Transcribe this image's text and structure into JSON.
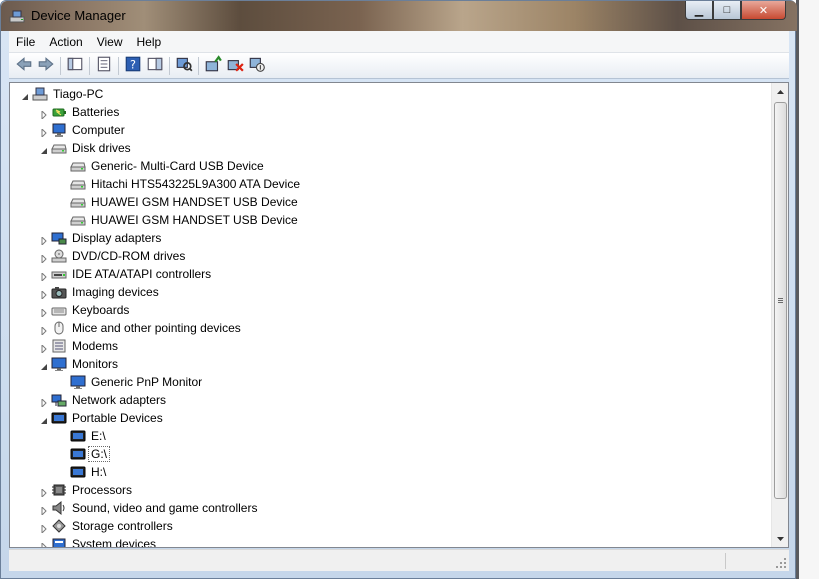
{
  "window": {
    "title": "Device Manager"
  },
  "caption": {
    "minimize": "▁",
    "maximize": "□",
    "close": "✕"
  },
  "menu": [
    "File",
    "Action",
    "View",
    "Help"
  ],
  "toolbar": [
    {
      "icon": "back-arrow-icon"
    },
    {
      "icon": "forward-arrow-icon"
    },
    {
      "sep": true
    },
    {
      "icon": "show-hide-console-tree-icon"
    },
    {
      "sep": true
    },
    {
      "icon": "properties-icon"
    },
    {
      "sep": true
    },
    {
      "icon": "help-icon"
    },
    {
      "icon": "action-pane-icon"
    },
    {
      "sep": true
    },
    {
      "icon": "scan-hardware-changes-icon"
    },
    {
      "sep": true
    },
    {
      "icon": "update-driver-icon"
    },
    {
      "icon": "uninstall-device-icon"
    },
    {
      "icon": "disable-device-icon"
    }
  ],
  "tree": [
    {
      "label": "Tiago-PC",
      "level": 0,
      "state": "expanded",
      "icon": "computer-root-icon"
    },
    {
      "label": "Batteries",
      "level": 1,
      "state": "collapsed",
      "icon": "battery-icon"
    },
    {
      "label": "Computer",
      "level": 1,
      "state": "collapsed",
      "icon": "computer-icon"
    },
    {
      "label": "Disk drives",
      "level": 1,
      "state": "expanded",
      "icon": "disk-drive-icon"
    },
    {
      "label": "Generic- Multi-Card USB Device",
      "level": 2,
      "state": "leaf",
      "icon": "disk-drive-icon"
    },
    {
      "label": "Hitachi HTS543225L9A300 ATA Device",
      "level": 2,
      "state": "leaf",
      "icon": "disk-drive-icon"
    },
    {
      "label": "HUAWEI GSM HANDSET USB Device",
      "level": 2,
      "state": "leaf",
      "icon": "disk-drive-icon"
    },
    {
      "label": "HUAWEI GSM HANDSET USB Device",
      "level": 2,
      "state": "leaf",
      "icon": "disk-drive-icon"
    },
    {
      "label": "Display adapters",
      "level": 1,
      "state": "collapsed",
      "icon": "display-adapter-icon"
    },
    {
      "label": "DVD/CD-ROM drives",
      "level": 1,
      "state": "collapsed",
      "icon": "dvd-drive-icon"
    },
    {
      "label": "IDE ATA/ATAPI controllers",
      "level": 1,
      "state": "collapsed",
      "icon": "ide-controller-icon"
    },
    {
      "label": "Imaging devices",
      "level": 1,
      "state": "collapsed",
      "icon": "camera-icon"
    },
    {
      "label": "Keyboards",
      "level": 1,
      "state": "collapsed",
      "icon": "keyboard-icon"
    },
    {
      "label": "Mice and other pointing devices",
      "level": 1,
      "state": "collapsed",
      "icon": "mouse-icon"
    },
    {
      "label": "Modems",
      "level": 1,
      "state": "collapsed",
      "icon": "modem-icon"
    },
    {
      "label": "Monitors",
      "level": 1,
      "state": "expanded",
      "icon": "monitor-icon"
    },
    {
      "label": "Generic PnP Monitor",
      "level": 2,
      "state": "leaf",
      "icon": "monitor-icon"
    },
    {
      "label": "Network adapters",
      "level": 1,
      "state": "collapsed",
      "icon": "network-adapter-icon"
    },
    {
      "label": "Portable Devices",
      "level": 1,
      "state": "expanded",
      "icon": "portable-device-icon"
    },
    {
      "label": "E:\\",
      "level": 2,
      "state": "leaf",
      "icon": "portable-device-icon"
    },
    {
      "label": "G:\\",
      "level": 2,
      "state": "leaf",
      "icon": "portable-device-icon",
      "selected": true
    },
    {
      "label": "H:\\",
      "level": 2,
      "state": "leaf",
      "icon": "portable-device-icon"
    },
    {
      "label": "Processors",
      "level": 1,
      "state": "collapsed",
      "icon": "processor-icon"
    },
    {
      "label": "Sound, video and game controllers",
      "level": 1,
      "state": "collapsed",
      "icon": "speaker-icon"
    },
    {
      "label": "Storage controllers",
      "level": 1,
      "state": "collapsed",
      "icon": "storage-controller-icon"
    },
    {
      "label": "System devices",
      "level": 1,
      "state": "collapsed",
      "icon": "system-device-icon"
    }
  ],
  "colors": {
    "accent": "#1f5fc8",
    "window_frame": "#c5d6ea"
  }
}
